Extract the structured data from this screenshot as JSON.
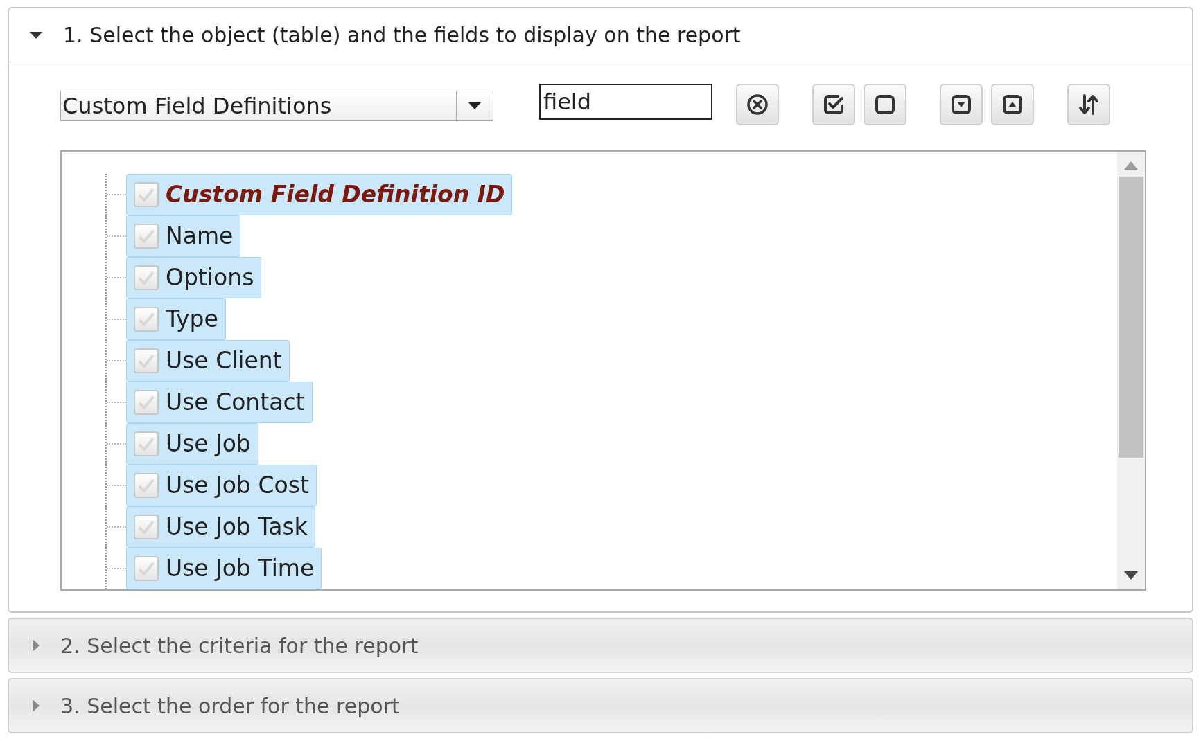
{
  "sections": [
    {
      "title": "1. Select the object (table) and the fields to display on the report",
      "expanded": true
    },
    {
      "title": "2. Select the criteria for the report",
      "expanded": false
    },
    {
      "title": "3. Select the order for the report",
      "expanded": false
    }
  ],
  "object_select": {
    "value": "Custom Field Definitions"
  },
  "filter_field": {
    "value": "field"
  },
  "toolbar": [
    {
      "kind": "clear"
    },
    {
      "kind": "check_all"
    },
    {
      "kind": "uncheck_all"
    },
    {
      "kind": "expand_all"
    },
    {
      "kind": "collapse_all"
    },
    {
      "kind": "sort"
    }
  ],
  "fields": [
    {
      "label": "Custom Field Definition ID",
      "kind": "key",
      "checked": true,
      "selected": true
    },
    {
      "label": "Name",
      "kind": "field",
      "checked": true,
      "selected": true
    },
    {
      "label": "Options",
      "kind": "field",
      "checked": true,
      "selected": true
    },
    {
      "label": "Type",
      "kind": "field",
      "checked": true,
      "selected": true
    },
    {
      "label": "Use Client",
      "kind": "field",
      "checked": true,
      "selected": true
    },
    {
      "label": "Use Contact",
      "kind": "field",
      "checked": true,
      "selected": true
    },
    {
      "label": "Use Job",
      "kind": "field",
      "checked": true,
      "selected": true
    },
    {
      "label": "Use Job Cost",
      "kind": "field",
      "checked": true,
      "selected": true
    },
    {
      "label": "Use Job Task",
      "kind": "field",
      "checked": true,
      "selected": true
    },
    {
      "label": "Use Job Time",
      "kind": "field",
      "checked": true,
      "selected": true
    }
  ]
}
